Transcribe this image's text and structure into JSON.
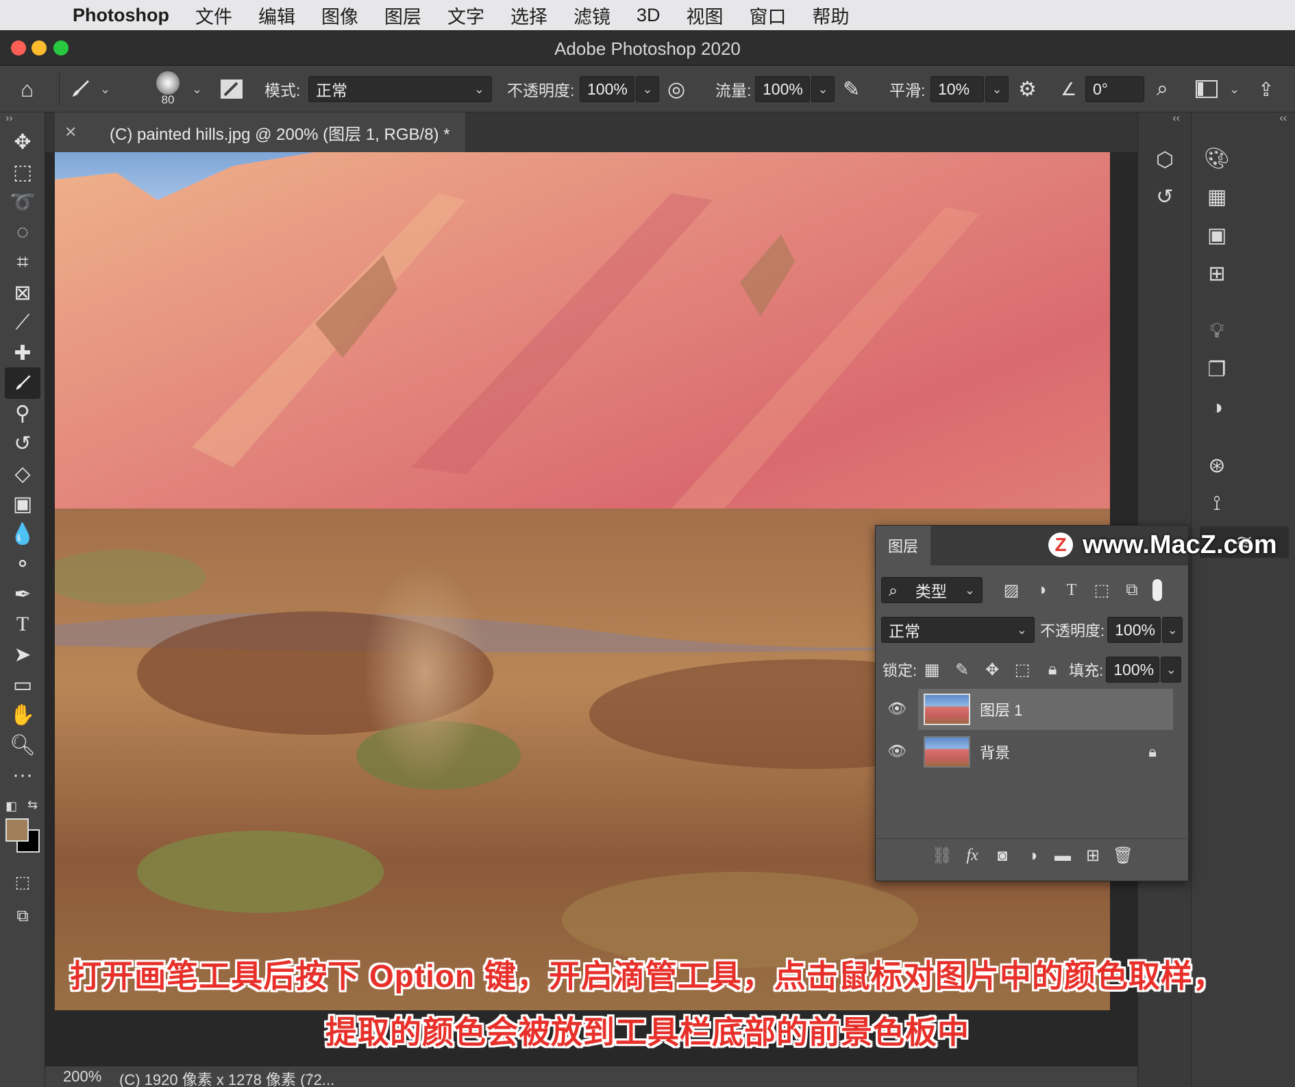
{
  "menubar": {
    "app_name": "Photoshop",
    "items": [
      "文件",
      "编辑",
      "图像",
      "图层",
      "文字",
      "选择",
      "滤镜",
      "3D",
      "视图",
      "窗口",
      "帮助"
    ]
  },
  "window": {
    "title": "Adobe Photoshop 2020"
  },
  "options": {
    "brush_size": "80",
    "mode_label": "模式:",
    "mode_value": "正常",
    "opacity_label": "不透明度:",
    "opacity_value": "100%",
    "flow_label": "流量:",
    "flow_value": "100%",
    "smoothing_label": "平滑:",
    "smoothing_value": "10%",
    "angle_value": "0°"
  },
  "document": {
    "tab_title": "(C) painted hills.jpg @ 200% (图层 1, RGB/8) *"
  },
  "status": {
    "zoom": "200%",
    "info": "(C) 1920 像素 x 1278 像素 (72..."
  },
  "layers_panel": {
    "tab": "图层",
    "filter_label": "类型",
    "blend_mode": "正常",
    "opacity_label": "不透明度:",
    "opacity_value": "100%",
    "lock_label": "锁定:",
    "fill_label": "填充:",
    "fill_value": "100%",
    "layers": [
      {
        "name": "图层 1",
        "selected": true,
        "locked": false
      },
      {
        "name": "背景",
        "selected": false,
        "locked": true
      }
    ]
  },
  "colors": {
    "foreground": "#a0805a",
    "background": "#000000",
    "accent": "#e8302a"
  },
  "watermark": {
    "text": "www.MacZ.com",
    "logo": "Z"
  },
  "subtitles": {
    "line1": "打开画笔工具后按下 Option 键，开启滴管工具，点击鼠标对图片中的颜色取样，",
    "line2": "提取的颜色会被放到工具栏底部的前景色板中"
  }
}
